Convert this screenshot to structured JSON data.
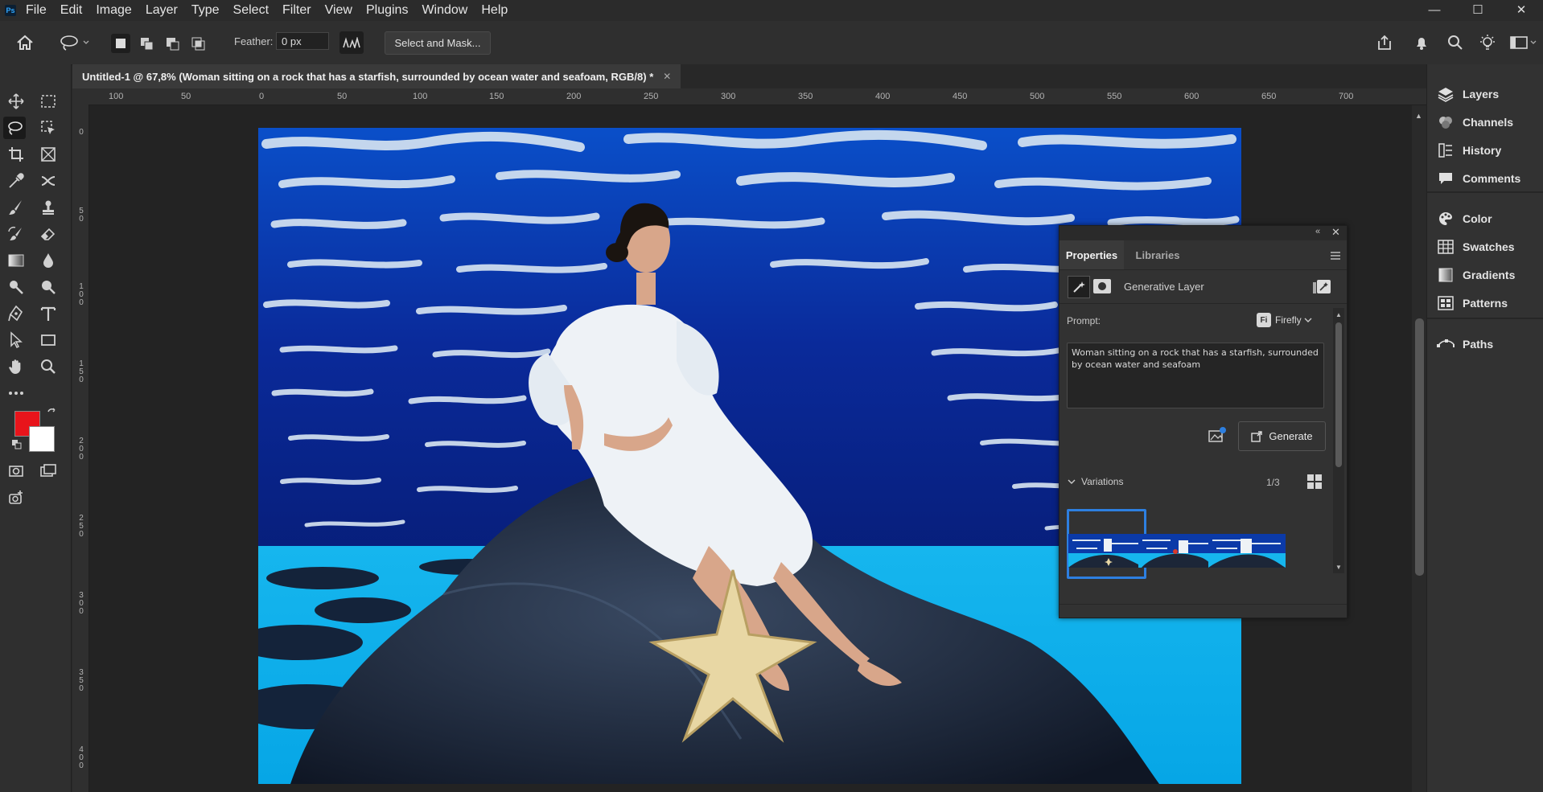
{
  "app": {
    "logo": "Ps"
  },
  "menu": [
    "File",
    "Edit",
    "Image",
    "Layer",
    "Type",
    "Select",
    "Filter",
    "View",
    "Plugins",
    "Window",
    "Help"
  ],
  "window_controls": {
    "minimize": "—",
    "maximize": "☐",
    "close": "✕"
  },
  "options_bar": {
    "feather_label": "Feather:",
    "feather_value": "0 px",
    "select_mask_label": "Select and Mask..."
  },
  "document": {
    "tab_title": "Untitled-1 @ 67,8% (Woman sitting on a rock that has a starfish, surrounded by ocean water and seafoam, RGB/8) *",
    "close_glyph": "✕",
    "zoom": "67,8%"
  },
  "ruler_h": [
    "100",
    "50",
    "0",
    "50",
    "100",
    "150",
    "200",
    "250",
    "300",
    "350",
    "400",
    "450",
    "500",
    "550",
    "600",
    "650",
    "700"
  ],
  "ruler_v": [
    "0",
    "5\n0",
    "1\n0\n0",
    "1\n5\n0",
    "2\n0\n0",
    "2\n5\n0",
    "3\n0\n0",
    "3\n5\n0",
    "4\n0\n0"
  ],
  "right_panels": [
    {
      "label": "Layers",
      "icon": "layers-icon"
    },
    {
      "label": "Channels",
      "icon": "channels-icon"
    },
    {
      "label": "History",
      "icon": "history-icon"
    },
    {
      "label": "Comments",
      "icon": "comments-icon"
    },
    {
      "label": "Color",
      "icon": "color-icon"
    },
    {
      "label": "Swatches",
      "icon": "swatches-icon"
    },
    {
      "label": "Gradients",
      "icon": "gradients-icon"
    },
    {
      "label": "Patterns",
      "icon": "patterns-icon"
    },
    {
      "label": "Paths",
      "icon": "paths-icon"
    }
  ],
  "properties": {
    "tabs": [
      "Properties",
      "Libraries"
    ],
    "layer_type": "Generative Layer",
    "prompt_label": "Prompt:",
    "model_badge": "Fi",
    "model_name": "Firefly",
    "prompt_text": "Woman sitting on a rock that has a starfish, surrounded by ocean water and seafoam",
    "generate_label": "Generate",
    "variations_label": "Variations",
    "variations_count": "1/3",
    "selected_variation": 1
  },
  "colors": {
    "foreground": "#e8141b",
    "background": "#ffffff",
    "accent": "#2d7fe0",
    "ocean_deep": "#0a2a8c",
    "ocean_light": "#12b8f0"
  }
}
